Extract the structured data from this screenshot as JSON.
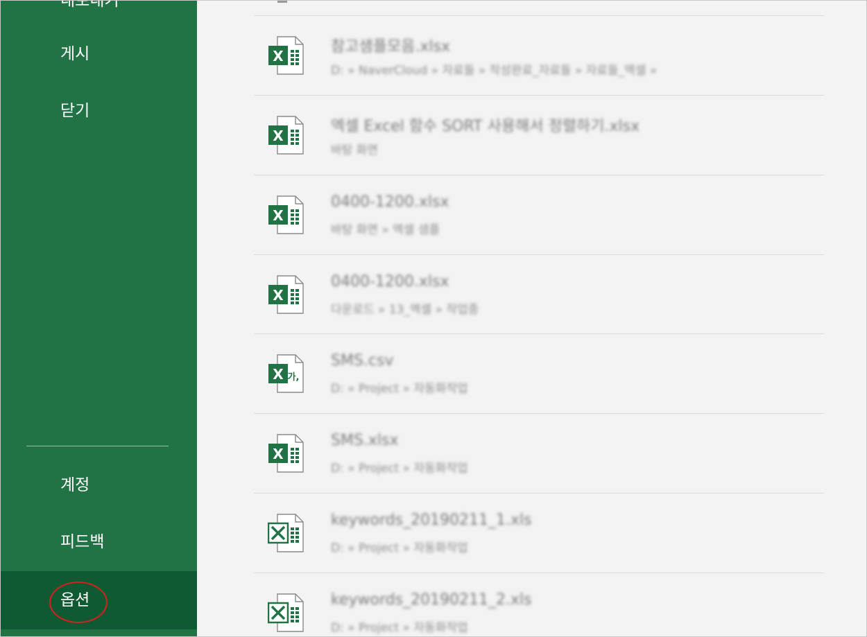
{
  "sidebar": {
    "partial_item": "내보내기",
    "items": [
      {
        "label": "게시"
      },
      {
        "label": "닫기"
      },
      {
        "label": "계정"
      },
      {
        "label": "피드백"
      },
      {
        "label": "옵션",
        "selected": true
      }
    ],
    "bg_color": "#217346",
    "selected_bg_color": "#0f5a32",
    "highlight_ring_color": "#d42020"
  },
  "files": [
    {
      "name": "참고샘플모음.xlsx",
      "path": "D: » NaverCloud » 자료들 » 작성완료_자료들 » 자료들_엑셀 »",
      "icon": "excel-file-icon"
    },
    {
      "name": "엑셀 Excel 함수 SORT 사용해서 정렬하기.xlsx",
      "path": "바탕 화면",
      "icon": "excel-file-icon"
    },
    {
      "name": "0400-1200.xlsx",
      "path": "바탕 화면 » 엑셀 샘플",
      "icon": "excel-file-icon"
    },
    {
      "name": "0400-1200.xlsx",
      "path": "다운로드 » 13_엑셀 » 작업중",
      "icon": "excel-file-icon"
    },
    {
      "name": "SMS.csv",
      "path": "D: » Project » 자동화작업",
      "icon": "excel-csv-icon"
    },
    {
      "name": "SMS.xlsx",
      "path": "D: » Project » 자동화작업",
      "icon": "excel-file-icon"
    },
    {
      "name": "keywords_20190211_1.xls",
      "path": "D: » Project » 자동화작업",
      "icon": "excel-legacy-icon"
    },
    {
      "name": "keywords_20190211_2.xls",
      "path": "D: » Project » 자동화작업",
      "icon": "excel-legacy-icon"
    }
  ]
}
